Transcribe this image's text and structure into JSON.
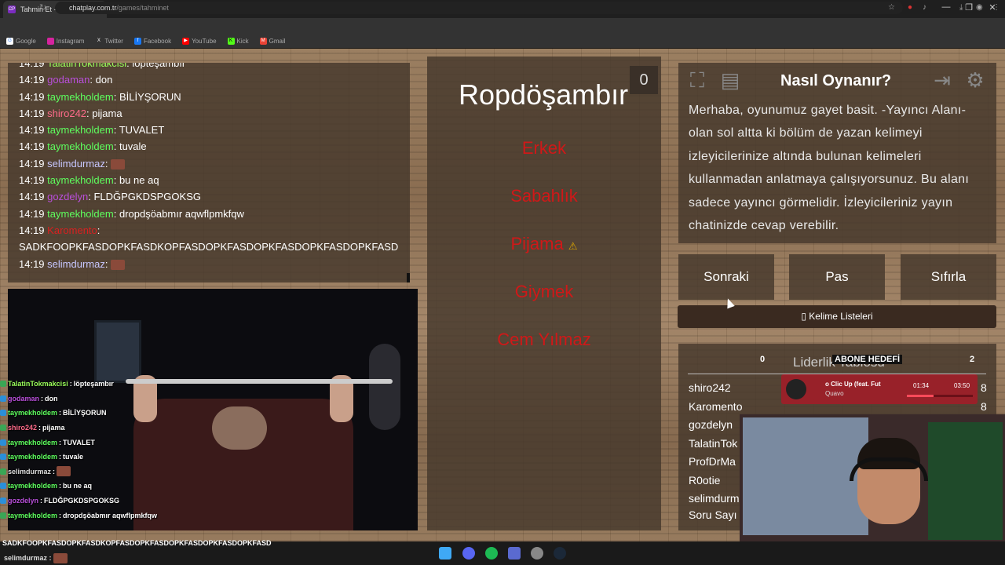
{
  "browser": {
    "tab_title": "Tahmin Et - ChatPlay",
    "tab_favicon": "CP",
    "new_tab": "+",
    "url_host": "chatplay.com.tr",
    "url_path": "/games/tahminet",
    "bookmarks": [
      "Google",
      "Instagram",
      "Twitter",
      "Facebook",
      "YouTube",
      "Kick",
      "Gmail"
    ]
  },
  "chat": {
    "messages": [
      {
        "time": "14:19",
        "user": "TalatinTokmakcisi",
        "color": "#9aff5a",
        "text": "löpteşambır"
      },
      {
        "time": "14:19",
        "user": "godaman",
        "color": "#b94fdb",
        "text": "don"
      },
      {
        "time": "14:19",
        "user": "taymekholdem",
        "color": "#5eff5e",
        "text": "BİLİYŞORUN"
      },
      {
        "time": "14:19",
        "user": "shiro242",
        "color": "#ff6b8a",
        "text": "pijama"
      },
      {
        "time": "14:19",
        "user": "taymekholdem",
        "color": "#5eff5e",
        "text": "TUVALET"
      },
      {
        "time": "14:19",
        "user": "taymekholdem",
        "color": "#5eff5e",
        "text": "tuvale"
      },
      {
        "time": "14:19",
        "user": "selimdurmaz",
        "color": "#c7c7ff",
        "text": ""
      },
      {
        "time": "14:19",
        "user": "taymekholdem",
        "color": "#5eff5e",
        "text": "bu ne aq"
      },
      {
        "time": "14:19",
        "user": "gozdelyn",
        "color": "#b94fdb",
        "text": "FLDĞPGKDSPGOKSG"
      },
      {
        "time": "14:19",
        "user": "taymekholdem",
        "color": "#5eff5e",
        "text": "dropdşöabmır aqwflpmkfqw"
      },
      {
        "time": "14:19",
        "user": "Karomento",
        "color": "#d92020",
        "text": ""
      },
      {
        "time": "",
        "user": "",
        "color": "#fff",
        "text": "SADKFOOPKFASDOPKFASDKOPFASDOPKFASDOPKFASDOPKFASDOPKFASD"
      },
      {
        "time": "14:19",
        "user": "selimdurmaz",
        "color": "#c7c7ff",
        "text": ""
      }
    ]
  },
  "overlay_chat": [
    {
      "user": "TalatinTokmakcisi",
      "color": "#9aff5a",
      "text": "löpteşambır"
    },
    {
      "user": "godaman",
      "color": "#b94fdb",
      "text": "don"
    },
    {
      "user": "taymekholdem",
      "color": "#5eff5e",
      "text": "BİLİYŞORUN"
    },
    {
      "user": "shiro242",
      "color": "#ff6b8a",
      "text": "pijama"
    },
    {
      "user": "taymekholdem",
      "color": "#5eff5e",
      "text": "TUVALET"
    },
    {
      "user": "taymekholdem",
      "color": "#5eff5e",
      "text": "tuvale"
    },
    {
      "user": "selimdurmaz",
      "color": "#dddddd",
      "text": ""
    },
    {
      "user": "taymekholdem",
      "color": "#5eff5e",
      "text": "bu ne aq"
    },
    {
      "user": "gozdelyn",
      "color": "#b94fdb",
      "text": "FLDĞPGKDSPGOKSG"
    },
    {
      "user": "taymekholdem",
      "color": "#5eff5e",
      "text": "dropdşöabmır aqwflpmkfqw"
    }
  ],
  "overlay_bottom": {
    "line1": "SADKFOOPKFASDOPKFASDKOPFASDOPKFASDOPKFASDOPKFASDOPKFASD",
    "line2": "selimdurmaz :"
  },
  "game": {
    "word": "Ropdöşambır",
    "score": "0",
    "taboo_words": [
      "Erkek",
      "Sabahlık",
      "Pijama",
      "Giymek",
      "Cem Yılmaz"
    ]
  },
  "howto": {
    "title": "Nasıl Oynanır?",
    "text": "Merhaba, oyunumuz gayet basit. -Yayıncı Alanı- olan sol altta ki bölüm de yazan kelimeyi izleyicilerinize altında bulunan kelimeleri kullanmadan anlatmaya çalışıyorsunuz. Bu alanı sadece yayıncı görmelidir. İzleyicileriniz yayın chatinizde cevap verebilir."
  },
  "buttons": {
    "next": "Sonraki",
    "pass": "Pas",
    "reset": "Sıfırla",
    "word_lists": "Kelime Listeleri"
  },
  "leaderboard": {
    "title": "Liderlik Tablosu",
    "rows": [
      {
        "name": "shiro242",
        "score": "8"
      },
      {
        "name": "Karomento",
        "score": "8"
      },
      {
        "name": "gozdelyn",
        "score": ""
      },
      {
        "name": "TalatinTok",
        "score": ""
      },
      {
        "name": "ProfDrMa",
        "score": ""
      },
      {
        "name": "R0otie",
        "score": ""
      },
      {
        "name": "selimdurm",
        "score": ""
      }
    ],
    "footer": "Soru Sayı"
  },
  "subgoal": {
    "label": "ABONE HEDEFİ",
    "current": "0",
    "target": "2"
  },
  "music": {
    "title": "o Clic Up (feat. Fut",
    "artist": "Quavo",
    "elapsed": "01:34",
    "total": "03:50",
    "progress": 0.41
  },
  "colors": {
    "taboo": "#d01818",
    "panel": "#46382c"
  }
}
